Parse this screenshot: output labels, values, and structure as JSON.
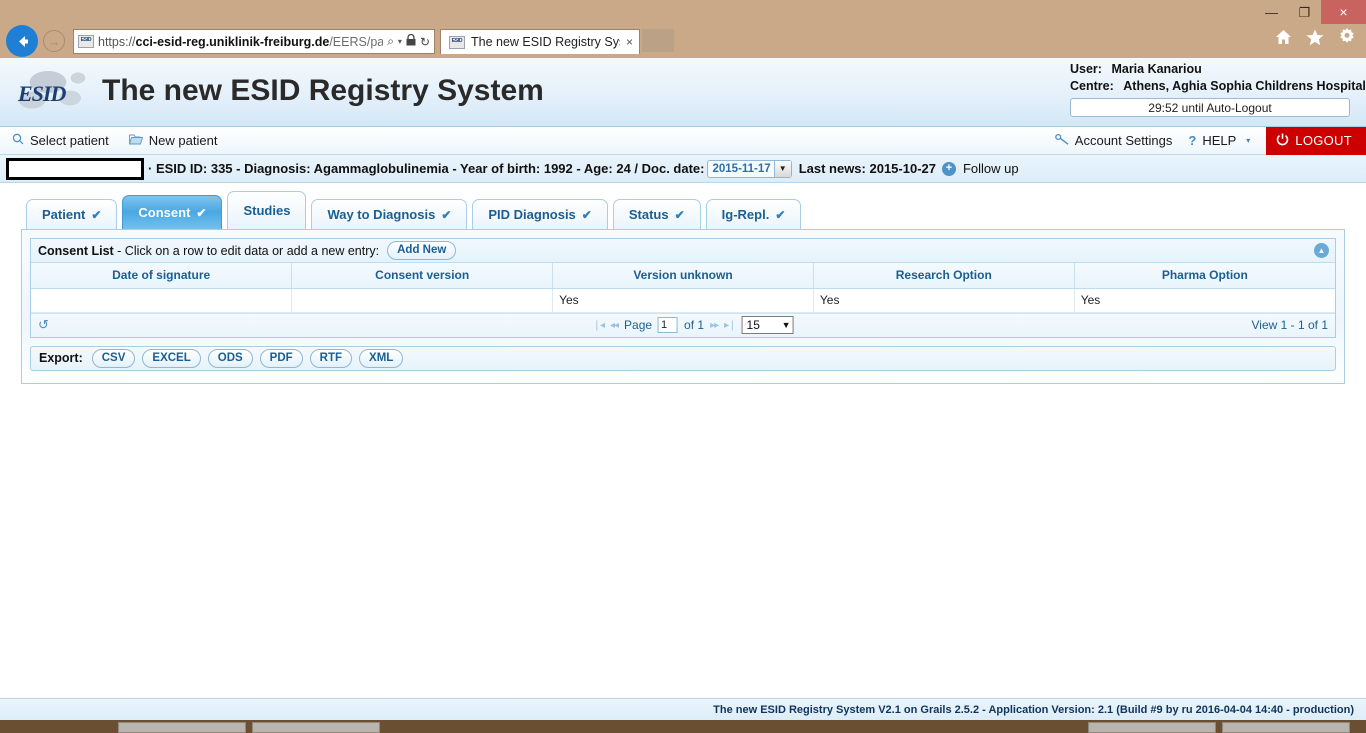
{
  "browser": {
    "url_scheme": "https://",
    "url_host": "cci-esid-reg.uniklinik-freiburg.de",
    "url_path": "/EERS/pati",
    "tab_title": "The new ESID Registry Syste...",
    "tab_close": "×",
    "search_icon": "⌕",
    "caret_icon": "▾",
    "lock_icon": "🔒",
    "refresh_icon": "↻",
    "back_icon": "←",
    "forward_icon": "→",
    "minimize": "—",
    "restore": "❐",
    "close": "×"
  },
  "header": {
    "logo_text": "ESID",
    "app_title": "The new ESID Registry System",
    "user_label": "User:",
    "user_value": "Maria Kanariou",
    "centre_label": "Centre:",
    "centre_value": "Athens, Aghia Sophia Childrens Hospital",
    "autologout": "29:52 until Auto-Logout"
  },
  "nav": {
    "select_patient": "Select patient",
    "new_patient": "New patient",
    "account_settings": "Account Settings",
    "help": "HELP",
    "help_q": "?",
    "help_caret": "▾",
    "logout": "LOGOUT"
  },
  "patient_bar": {
    "name_redacted": "",
    "separator": "·",
    "esid_id": "ESID ID: 335",
    "diagnosis": "Diagnosis: Agammaglobulinemia",
    "year_of_birth": "Year of birth: 1992",
    "age": "Age: 24",
    "slash": "/",
    "doc_date_label": "Doc. date:",
    "doc_date_value": "2015-11-17",
    "last_news": "Last news: 2015-10-27",
    "plus": "+",
    "follow_up": "Follow up",
    "info_line": "· ESID ID: 335 - Diagnosis: Agammaglobulinemia - Year of birth: 1992 - Age: 24  /  Doc. date:",
    "info_line_tail": "Last news: 2015-10-27"
  },
  "tabs": [
    {
      "label": "Patient",
      "check": "✔",
      "active": false,
      "tall": false
    },
    {
      "label": "Consent",
      "check": "✔",
      "active": true,
      "tall": false
    },
    {
      "label": "Studies",
      "check": "",
      "active": false,
      "tall": true
    },
    {
      "label": "Way to Diagnosis",
      "check": "✔",
      "active": false,
      "tall": false
    },
    {
      "label": "PID Diagnosis",
      "check": "✔",
      "active": false,
      "tall": false
    },
    {
      "label": "Status",
      "check": "✔",
      "active": false,
      "tall": false
    },
    {
      "label": "Ig-Repl.",
      "check": "✔",
      "active": false,
      "tall": false
    }
  ],
  "grid": {
    "title_bold": "Consent List",
    "title_rest": " - Click on a row to edit data or add a new entry:",
    "add_new": "Add New",
    "collapse_icon": "▲",
    "columns": [
      "Date of signature",
      "Consent version",
      "Version unknown",
      "Research Option",
      "Pharma Option"
    ],
    "rows": [
      [
        "",
        "",
        "Yes",
        "Yes",
        "Yes"
      ]
    ],
    "footer": {
      "refresh_icon": "↺",
      "first_icon": "❘◂",
      "prev_icon": "◂◂",
      "page_label": "Page",
      "page_value": "1",
      "of_label": "of 1",
      "next_icon": "▸▸",
      "last_icon": "▸❘",
      "page_size": "15",
      "select_arrow": "▼",
      "view_count": "View 1 - 1 of 1"
    }
  },
  "export": {
    "label": "Export:",
    "formats": [
      "CSV",
      "EXCEL",
      "ODS",
      "PDF",
      "RTF",
      "XML"
    ]
  },
  "footer": {
    "text": "The new ESID Registry System V2.1 on Grails 2.5.2 - Application Version: 2.1 (Build #9 by ru 2016-04-04 14:40 - production)"
  },
  "colors": {
    "accent_blue": "#1a5f93",
    "active_tab": "#4aa8e3",
    "logout_red": "#cc0000",
    "chrome_tan": "#c9a988"
  }
}
